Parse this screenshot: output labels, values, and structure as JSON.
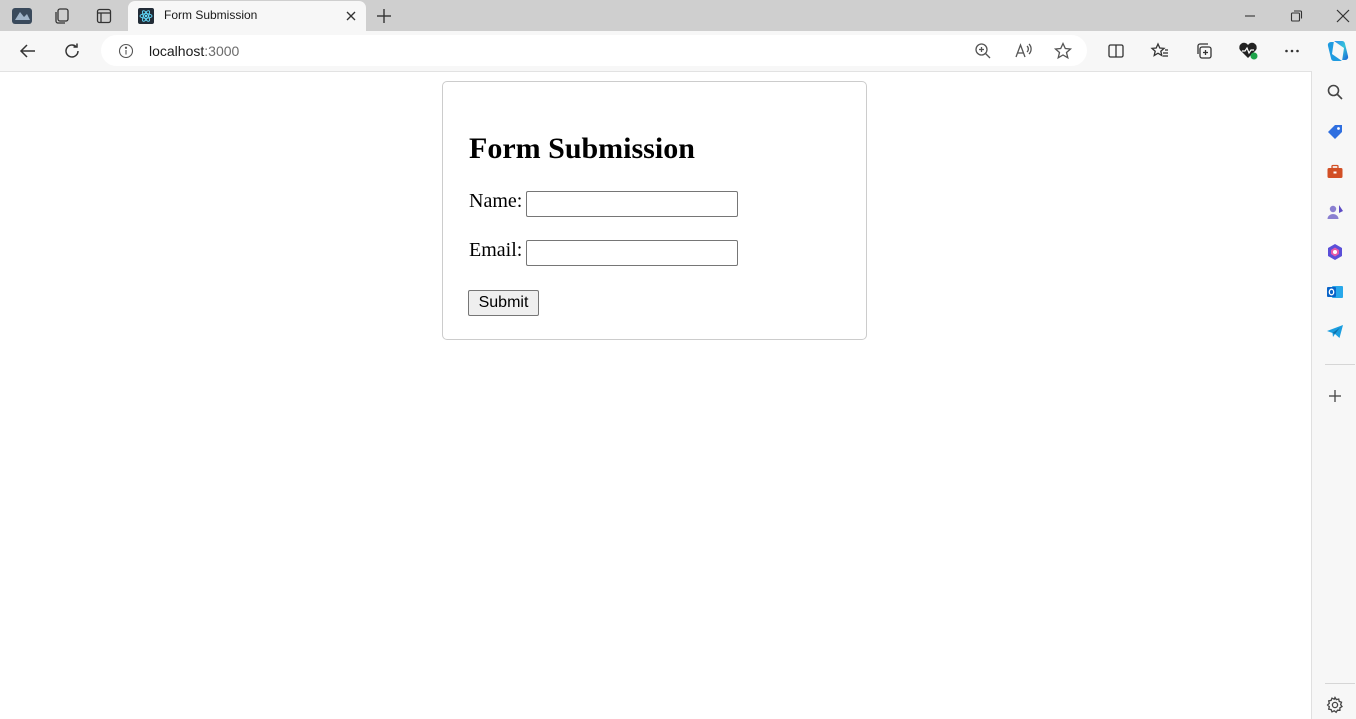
{
  "browser": {
    "tab": {
      "title": "Form Submission",
      "favicon": "react-logo-icon"
    },
    "address": {
      "host": "localhost",
      "port": ":3000"
    },
    "tabstrip_icons": [
      "profile-avatar-icon",
      "workspaces-icon",
      "vertical-tabs-icon"
    ],
    "toolbar_icons": [
      "back-icon",
      "refresh-icon",
      "zoom-icon",
      "read-aloud-icon",
      "favorite-star-icon",
      "split-screen-icon",
      "favorites-icon",
      "collections-icon",
      "browser-essentials-icon",
      "more-options-icon",
      "copilot-icon"
    ],
    "sidebar_icons": [
      "search-icon",
      "shopping-tag-icon",
      "tools-briefcase-icon",
      "games-icon",
      "microsoft365-icon",
      "outlook-icon",
      "telegram-icon",
      "add-icon",
      "settings-gear-icon"
    ],
    "accent_color": "#0c59a4"
  },
  "form": {
    "heading": "Form Submission",
    "name_label": "Name:",
    "name_value": "",
    "email_label": "Email:",
    "email_value": "",
    "submit_label": "Submit"
  }
}
